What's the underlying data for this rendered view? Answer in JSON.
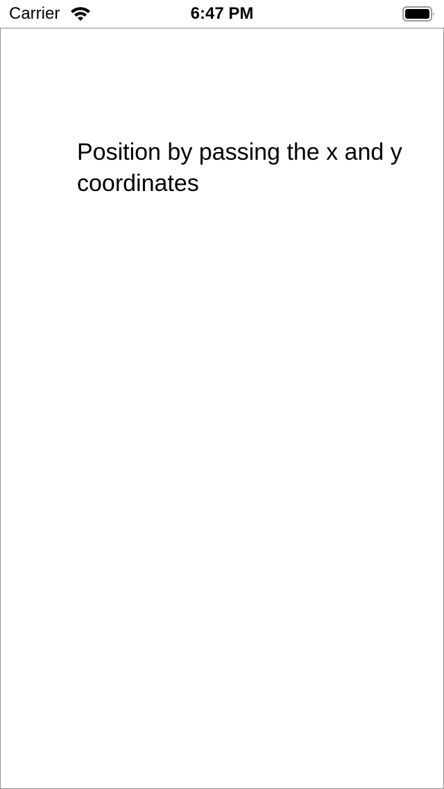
{
  "status_bar": {
    "carrier": "Carrier",
    "time": "6:47 PM",
    "wifi_icon": "wifi-icon",
    "battery_icon": "battery-icon"
  },
  "main": {
    "label": "Position by passing the x and y coordinates"
  },
  "colors": {
    "background": "#ffffff",
    "text": "#000000",
    "frame_border": "#8e8e8e"
  }
}
